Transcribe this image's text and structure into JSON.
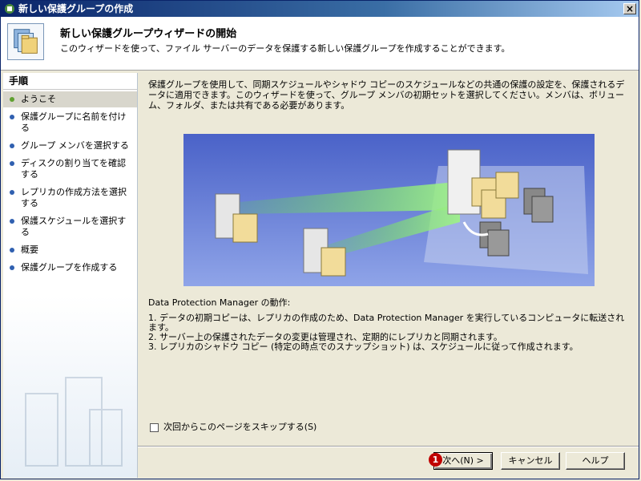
{
  "window": {
    "title": "新しい保護グループの作成",
    "close_label": "×"
  },
  "header": {
    "title": "新しい保護グループウィザードの開始",
    "description": "このウィザードを使って、ファイル サーバーのデータを保護する新しい保護グループを作成することができます。"
  },
  "sidebar": {
    "heading": "手順",
    "items": [
      {
        "label": "ようこそ"
      },
      {
        "label": "保護グループに名前を付ける"
      },
      {
        "label": "グループ メンバを選択する"
      },
      {
        "label": "ディスクの割り当てを確認する"
      },
      {
        "label": "レプリカの作成方法を選択する"
      },
      {
        "label": "保護スケジュールを選択する"
      },
      {
        "label": "概要"
      },
      {
        "label": "保護グループを作成する"
      }
    ]
  },
  "main": {
    "intro": "保護グループを使用して、同期スケジュールやシャドウ コピーのスケジュールなどの共通の保護の設定を、保護されるデータに適用できます。このウィザードを使って、グループ メンバの初期セットを選択してください。メンバは、ボリューム、フォルダ、または共有である必要があります。",
    "dpm_title": "Data Protection Manager の動作:",
    "steps": [
      "1. データの初期コピーは、レプリカの作成のため、Data Protection Manager を実行しているコンピュータに転送されます。",
      "2. サーバー上の保護されたデータの変更は管理され、定期的にレプリカと同期されます。",
      "3. レプリカのシャドウ コピー (特定の時点でのスナップショット) は、スケジュールに従って作成されます。"
    ],
    "skip_label": "次回からこのページをスキップする(S)",
    "skip_checked": false
  },
  "buttons": {
    "next": "次へ(N) >",
    "cancel": "キャンセル",
    "help": "ヘルプ"
  },
  "callout": "1"
}
